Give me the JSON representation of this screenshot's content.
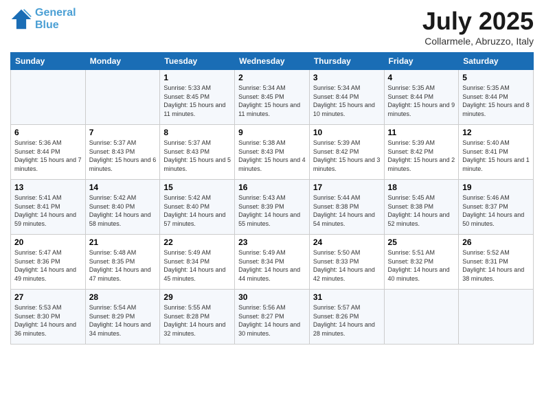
{
  "logo": {
    "line1": "General",
    "line2": "Blue"
  },
  "title": "July 2025",
  "location": "Collarmele, Abruzzo, Italy",
  "weekdays": [
    "Sunday",
    "Monday",
    "Tuesday",
    "Wednesday",
    "Thursday",
    "Friday",
    "Saturday"
  ],
  "weeks": [
    [
      {
        "day": "",
        "sunrise": "",
        "sunset": "",
        "daylight": ""
      },
      {
        "day": "",
        "sunrise": "",
        "sunset": "",
        "daylight": ""
      },
      {
        "day": "1",
        "sunrise": "Sunrise: 5:33 AM",
        "sunset": "Sunset: 8:45 PM",
        "daylight": "Daylight: 15 hours and 11 minutes."
      },
      {
        "day": "2",
        "sunrise": "Sunrise: 5:34 AM",
        "sunset": "Sunset: 8:45 PM",
        "daylight": "Daylight: 15 hours and 11 minutes."
      },
      {
        "day": "3",
        "sunrise": "Sunrise: 5:34 AM",
        "sunset": "Sunset: 8:44 PM",
        "daylight": "Daylight: 15 hours and 10 minutes."
      },
      {
        "day": "4",
        "sunrise": "Sunrise: 5:35 AM",
        "sunset": "Sunset: 8:44 PM",
        "daylight": "Daylight: 15 hours and 9 minutes."
      },
      {
        "day": "5",
        "sunrise": "Sunrise: 5:35 AM",
        "sunset": "Sunset: 8:44 PM",
        "daylight": "Daylight: 15 hours and 8 minutes."
      }
    ],
    [
      {
        "day": "6",
        "sunrise": "Sunrise: 5:36 AM",
        "sunset": "Sunset: 8:44 PM",
        "daylight": "Daylight: 15 hours and 7 minutes."
      },
      {
        "day": "7",
        "sunrise": "Sunrise: 5:37 AM",
        "sunset": "Sunset: 8:43 PM",
        "daylight": "Daylight: 15 hours and 6 minutes."
      },
      {
        "day": "8",
        "sunrise": "Sunrise: 5:37 AM",
        "sunset": "Sunset: 8:43 PM",
        "daylight": "Daylight: 15 hours and 5 minutes."
      },
      {
        "day": "9",
        "sunrise": "Sunrise: 5:38 AM",
        "sunset": "Sunset: 8:43 PM",
        "daylight": "Daylight: 15 hours and 4 minutes."
      },
      {
        "day": "10",
        "sunrise": "Sunrise: 5:39 AM",
        "sunset": "Sunset: 8:42 PM",
        "daylight": "Daylight: 15 hours and 3 minutes."
      },
      {
        "day": "11",
        "sunrise": "Sunrise: 5:39 AM",
        "sunset": "Sunset: 8:42 PM",
        "daylight": "Daylight: 15 hours and 2 minutes."
      },
      {
        "day": "12",
        "sunrise": "Sunrise: 5:40 AM",
        "sunset": "Sunset: 8:41 PM",
        "daylight": "Daylight: 15 hours and 1 minute."
      }
    ],
    [
      {
        "day": "13",
        "sunrise": "Sunrise: 5:41 AM",
        "sunset": "Sunset: 8:41 PM",
        "daylight": "Daylight: 14 hours and 59 minutes."
      },
      {
        "day": "14",
        "sunrise": "Sunrise: 5:42 AM",
        "sunset": "Sunset: 8:40 PM",
        "daylight": "Daylight: 14 hours and 58 minutes."
      },
      {
        "day": "15",
        "sunrise": "Sunrise: 5:42 AM",
        "sunset": "Sunset: 8:40 PM",
        "daylight": "Daylight: 14 hours and 57 minutes."
      },
      {
        "day": "16",
        "sunrise": "Sunrise: 5:43 AM",
        "sunset": "Sunset: 8:39 PM",
        "daylight": "Daylight: 14 hours and 55 minutes."
      },
      {
        "day": "17",
        "sunrise": "Sunrise: 5:44 AM",
        "sunset": "Sunset: 8:38 PM",
        "daylight": "Daylight: 14 hours and 54 minutes."
      },
      {
        "day": "18",
        "sunrise": "Sunrise: 5:45 AM",
        "sunset": "Sunset: 8:38 PM",
        "daylight": "Daylight: 14 hours and 52 minutes."
      },
      {
        "day": "19",
        "sunrise": "Sunrise: 5:46 AM",
        "sunset": "Sunset: 8:37 PM",
        "daylight": "Daylight: 14 hours and 50 minutes."
      }
    ],
    [
      {
        "day": "20",
        "sunrise": "Sunrise: 5:47 AM",
        "sunset": "Sunset: 8:36 PM",
        "daylight": "Daylight: 14 hours and 49 minutes."
      },
      {
        "day": "21",
        "sunrise": "Sunrise: 5:48 AM",
        "sunset": "Sunset: 8:35 PM",
        "daylight": "Daylight: 14 hours and 47 minutes."
      },
      {
        "day": "22",
        "sunrise": "Sunrise: 5:49 AM",
        "sunset": "Sunset: 8:34 PM",
        "daylight": "Daylight: 14 hours and 45 minutes."
      },
      {
        "day": "23",
        "sunrise": "Sunrise: 5:49 AM",
        "sunset": "Sunset: 8:34 PM",
        "daylight": "Daylight: 14 hours and 44 minutes."
      },
      {
        "day": "24",
        "sunrise": "Sunrise: 5:50 AM",
        "sunset": "Sunset: 8:33 PM",
        "daylight": "Daylight: 14 hours and 42 minutes."
      },
      {
        "day": "25",
        "sunrise": "Sunrise: 5:51 AM",
        "sunset": "Sunset: 8:32 PM",
        "daylight": "Daylight: 14 hours and 40 minutes."
      },
      {
        "day": "26",
        "sunrise": "Sunrise: 5:52 AM",
        "sunset": "Sunset: 8:31 PM",
        "daylight": "Daylight: 14 hours and 38 minutes."
      }
    ],
    [
      {
        "day": "27",
        "sunrise": "Sunrise: 5:53 AM",
        "sunset": "Sunset: 8:30 PM",
        "daylight": "Daylight: 14 hours and 36 minutes."
      },
      {
        "day": "28",
        "sunrise": "Sunrise: 5:54 AM",
        "sunset": "Sunset: 8:29 PM",
        "daylight": "Daylight: 14 hours and 34 minutes."
      },
      {
        "day": "29",
        "sunrise": "Sunrise: 5:55 AM",
        "sunset": "Sunset: 8:28 PM",
        "daylight": "Daylight: 14 hours and 32 minutes."
      },
      {
        "day": "30",
        "sunrise": "Sunrise: 5:56 AM",
        "sunset": "Sunset: 8:27 PM",
        "daylight": "Daylight: 14 hours and 30 minutes."
      },
      {
        "day": "31",
        "sunrise": "Sunrise: 5:57 AM",
        "sunset": "Sunset: 8:26 PM",
        "daylight": "Daylight: 14 hours and 28 minutes."
      },
      {
        "day": "",
        "sunrise": "",
        "sunset": "",
        "daylight": ""
      },
      {
        "day": "",
        "sunrise": "",
        "sunset": "",
        "daylight": ""
      }
    ]
  ]
}
